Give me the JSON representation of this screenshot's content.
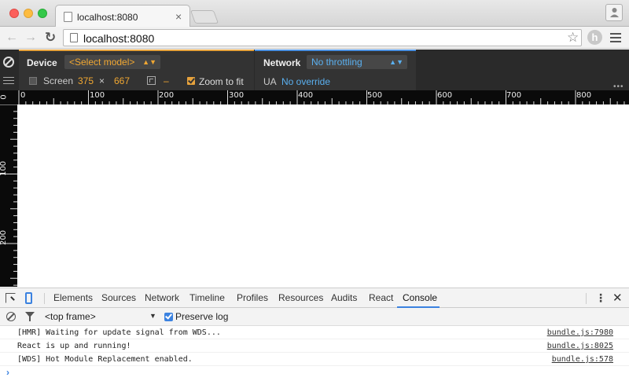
{
  "browser": {
    "tab_title": "localhost:8080",
    "tab_close": "×",
    "url": "localhost:8080"
  },
  "device_bar": {
    "device_label": "Device",
    "model_select": "<Select model>",
    "screen_label": "Screen",
    "width": "375",
    "times": "×",
    "height": "667",
    "dpr": "–",
    "zoom_label": "Zoom to fit",
    "network_label": "Network",
    "throttle_select": "No throttling",
    "ua_label": "UA",
    "ua_value": "No override"
  },
  "rulers": {
    "horizontal": [
      "0",
      "100",
      "200",
      "300",
      "400",
      "500",
      "600",
      "700",
      "800"
    ],
    "vertical": [
      "0",
      "100",
      "200"
    ]
  },
  "devtools": {
    "tabs": [
      "Elements",
      "Sources",
      "Network",
      "Timeline",
      "Profiles",
      "Resources",
      "Audits",
      "React",
      "Console"
    ],
    "active_tab": "Console",
    "frame_select": "<top frame>",
    "preserve_log": "Preserve log",
    "console": [
      {
        "message": "[HMR] Waiting for update signal from WDS...",
        "source": "bundle.js:7980"
      },
      {
        "message": "React is up and running!",
        "source": "bundle.js:8025"
      },
      {
        "message": "[WDS] Hot Module Replacement enabled.",
        "source": "bundle.js:578"
      }
    ],
    "prompt": "›"
  },
  "colors": {
    "device_accent": "#e6a23c",
    "network_accent": "#4a90e2",
    "devtools_accent": "#3b82e0"
  }
}
